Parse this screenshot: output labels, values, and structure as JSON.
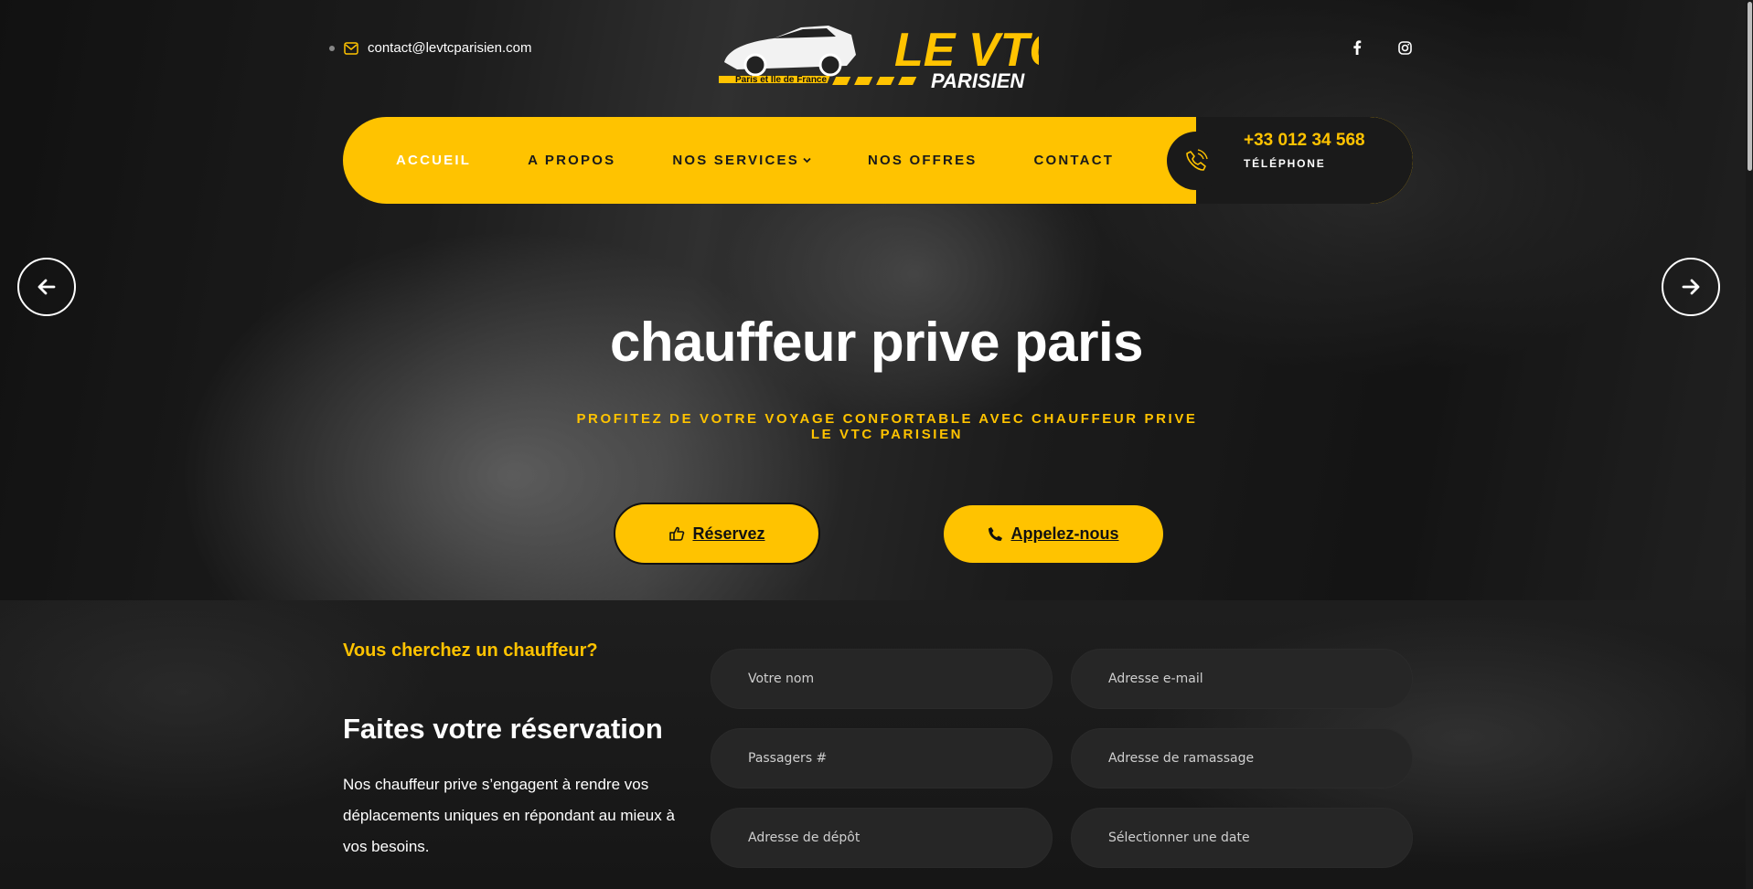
{
  "topbar": {
    "email": "contact@levtcparisien.com",
    "icons": [
      "mail-icon",
      "facebook-icon",
      "instagram-icon"
    ]
  },
  "logo": {
    "brand_line1": "LE VTC",
    "brand_line2": "PARISIEN",
    "tagline": "Paris et Ile de France"
  },
  "nav": {
    "items": [
      {
        "label": "ACCUEIL",
        "active": true
      },
      {
        "label": "A PROPOS",
        "active": false
      },
      {
        "label": "NOS SERVICES",
        "active": false,
        "has_dropdown": true
      },
      {
        "label": "NOS OFFRES",
        "active": false
      },
      {
        "label": "CONTACT",
        "active": false
      }
    ],
    "phone_number": "+33 012 34 568",
    "phone_label": "TÉLÉPHONE"
  },
  "hero": {
    "title": "chauffeur prive paris",
    "subtitle": "PROFITEZ DE VOTRE VOYAGE CONFORTABLE AVEC CHAUFFEUR PRIVE LE VTC PARISIEN",
    "reserve_label": "Réservez",
    "call_label": "Appelez-nous"
  },
  "booking": {
    "kicker": "Vous cherchez un chauffeur?",
    "title": "Faites votre réservation",
    "description": "Nos chauffeur prive s’engagent à rendre vos déplacements uniques en répondant au mieux à vos besoins.",
    "fields": {
      "name": "Votre nom",
      "email": "Adresse e-mail",
      "passengers": "Passagers #",
      "pickup": "Adresse de ramassage",
      "dropoff": "Adresse de dépôt",
      "date": "Sélectionner une date"
    }
  },
  "colors": {
    "accent": "#ffc300",
    "dark": "#1a1a1a"
  }
}
